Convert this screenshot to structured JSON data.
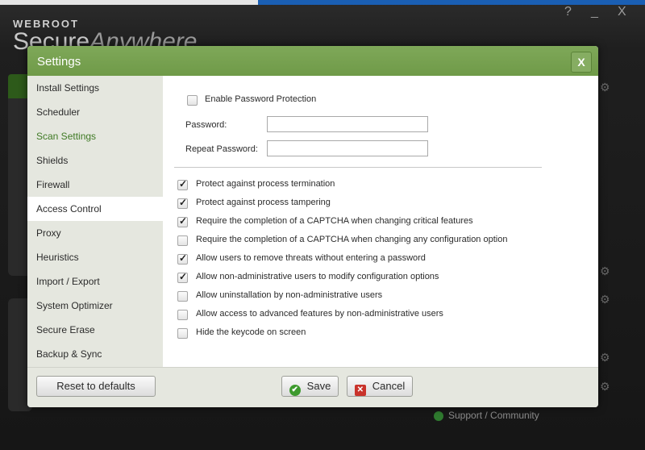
{
  "app": {
    "brand_small": "WEBROOT",
    "brand_big_bold": "Secure",
    "brand_big_italic": "Anywhere",
    "window_controls": [
      "?",
      "_",
      "X"
    ],
    "support_link": "Support / Community"
  },
  "dialog": {
    "title": "Settings",
    "close_label": "X",
    "sidebar": {
      "items": [
        {
          "label": "Install Settings"
        },
        {
          "label": "Scheduler"
        },
        {
          "label": "Scan Settings"
        },
        {
          "label": "Shields"
        },
        {
          "label": "Firewall"
        },
        {
          "label": "Access Control"
        },
        {
          "label": "Proxy"
        },
        {
          "label": "Heuristics"
        },
        {
          "label": "Import / Export"
        },
        {
          "label": "System Optimizer"
        },
        {
          "label": "Secure Erase"
        },
        {
          "label": "Backup & Sync"
        }
      ],
      "selected": "Access Control"
    },
    "password_section": {
      "enable_label": "Enable Password Protection",
      "enable_checked": false,
      "password_label": "Password:",
      "password_value": "",
      "repeat_label": "Repeat Password:",
      "repeat_value": ""
    },
    "options": [
      {
        "label": "Protect against process termination",
        "checked": true
      },
      {
        "label": "Protect against process tampering",
        "checked": true
      },
      {
        "label": "Require the completion of a CAPTCHA when changing critical features",
        "checked": true
      },
      {
        "label": "Require the completion of a CAPTCHA when changing any configuration option",
        "checked": false
      },
      {
        "label": "Allow users to remove threats without entering a password",
        "checked": true
      },
      {
        "label": "Allow non-administrative users to modify configuration options",
        "checked": true
      },
      {
        "label": "Allow uninstallation by non-administrative users",
        "checked": false
      },
      {
        "label": "Allow access to advanced features by non-administrative users",
        "checked": false
      },
      {
        "label": "Hide the keycode on screen",
        "checked": false
      }
    ],
    "footer": {
      "reset_label": "Reset to defaults",
      "save_label": "Save",
      "cancel_label": "Cancel"
    }
  },
  "colors": {
    "titlebar": "#76a14f",
    "sidebar_bg": "#e5e7df",
    "accent_green_text": "#3f7a25",
    "save_icon": "#3d9a2d",
    "cancel_icon": "#c9332b"
  }
}
